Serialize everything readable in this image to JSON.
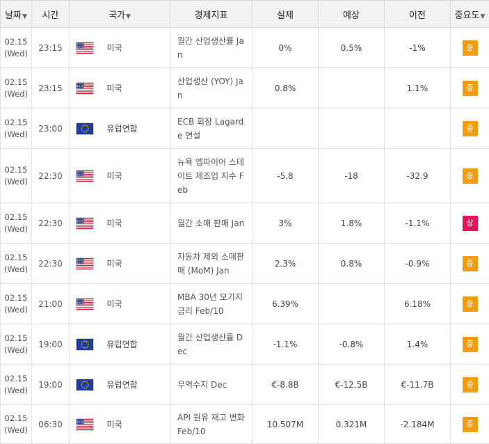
{
  "colors": {
    "medium": "#f39c12",
    "high": "#e8145b"
  },
  "header": {
    "date": "날짜",
    "time": "시간",
    "country": "국가",
    "indicator": "경제지표",
    "actual": "실제",
    "forecast": "예상",
    "previous": "이전",
    "importance": "중요도",
    "caret": "▼"
  },
  "rows": [
    {
      "date": "02.15",
      "weekday": "(Wed)",
      "time": "23:15",
      "flag": "us-flag-icon",
      "country": "미국",
      "indicator": "월간 산업생산률 Jan",
      "actual": "0%",
      "forecast": "0.5%",
      "previous": "-1%",
      "importance": "중",
      "level": "medium"
    },
    {
      "date": "02.15",
      "weekday": "(Wed)",
      "time": "23:15",
      "flag": "us-flag-icon",
      "country": "미국",
      "indicator": "산업생산 (YOY) Jan",
      "actual": "0.8%",
      "forecast": "",
      "previous": "1.1%",
      "importance": "중",
      "level": "medium"
    },
    {
      "date": "02.15",
      "weekday": "(Wed)",
      "time": "23:00",
      "flag": "eu-flag-icon",
      "country": "유럽연합",
      "indicator": "ECB 회장 Lagarde 연설",
      "actual": "",
      "forecast": "",
      "previous": "",
      "importance": "중",
      "level": "medium"
    },
    {
      "date": "02.15",
      "weekday": "(Wed)",
      "time": "22:30",
      "flag": "us-flag-icon",
      "country": "미국",
      "indicator": "뉴욕 엠파이어 스테이트 제조업 지수 Feb",
      "actual": "-5.8",
      "forecast": "-18",
      "previous": "-32.9",
      "importance": "중",
      "level": "medium"
    },
    {
      "date": "02.15",
      "weekday": "(Wed)",
      "time": "22:30",
      "flag": "us-flag-icon",
      "country": "미국",
      "indicator": "월간 소매 판매 Jan",
      "actual": "3%",
      "forecast": "1.8%",
      "previous": "-1.1%",
      "importance": "상",
      "level": "high"
    },
    {
      "date": "02.15",
      "weekday": "(Wed)",
      "time": "22:30",
      "flag": "us-flag-icon",
      "country": "미국",
      "indicator": "자동차 제외 소매판매 (MoM) Jan",
      "actual": "2.3%",
      "forecast": "0.8%",
      "previous": "-0.9%",
      "importance": "중",
      "level": "medium"
    },
    {
      "date": "02.15",
      "weekday": "(Wed)",
      "time": "21:00",
      "flag": "us-flag-icon",
      "country": "미국",
      "indicator": "MBA 30년 모기지 금리 Feb/10",
      "actual": "6.39%",
      "forecast": "",
      "previous": "6.18%",
      "importance": "중",
      "level": "medium"
    },
    {
      "date": "02.15",
      "weekday": "(Wed)",
      "time": "19:00",
      "flag": "eu-flag-icon",
      "country": "유럽연합",
      "indicator": "월간 산업생산률 Dec",
      "actual": "-1.1%",
      "forecast": "-0.8%",
      "previous": "1.4%",
      "importance": "중",
      "level": "medium"
    },
    {
      "date": "02.15",
      "weekday": "(Wed)",
      "time": "19:00",
      "flag": "eu-flag-icon",
      "country": "유럽연합",
      "indicator": "무역수지 Dec",
      "actual": "€-8.8B",
      "forecast": "€-12.5B",
      "previous": "€-11.7B",
      "importance": "중",
      "level": "medium"
    },
    {
      "date": "02.15",
      "weekday": "(Wed)",
      "time": "06:30",
      "flag": "us-flag-icon",
      "country": "미국",
      "indicator": "API 원유 재고 변화 Feb/10",
      "actual": "10.507M",
      "forecast": "0.321M",
      "previous": "-2.184M",
      "importance": "중",
      "level": "medium"
    }
  ]
}
